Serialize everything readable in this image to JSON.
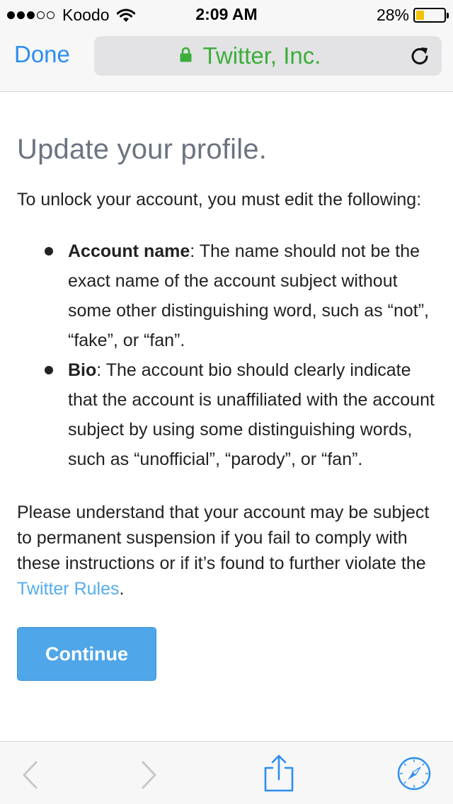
{
  "status_bar": {
    "carrier": "Koodo",
    "time": "2:09 AM",
    "battery": "28%",
    "battery_level": 0.28,
    "signal_bars_filled": 3,
    "signal_bars_total": 5
  },
  "nav": {
    "done_label": "Done",
    "url_text": "Twitter, Inc.",
    "secure_color": "#3aae3a"
  },
  "page": {
    "title": "Update your profile.",
    "intro": "To unlock your account, you must edit the following:",
    "rules": [
      {
        "term": "Account name",
        "text": ": The name should not be the exact name of the account subject without some other distinguishing word, such as “not”, “fake”, or “fan”."
      },
      {
        "term": "Bio",
        "text": ": The account bio should clearly indicate that the account is unaffiliated with the account subject by using some distinguishing words, such as “unofficial”, “parody”, or “fan”."
      }
    ],
    "closing_text": "Please understand that your account may be subject to permanent suspension if you fail to comply with these instructions or if it’s found to further violate the ",
    "rules_link": "Twitter Rules",
    "closing_end": ".",
    "continue_label": "Continue"
  },
  "toolbar": {
    "icons": [
      "back-icon",
      "forward-icon",
      "share-icon",
      "compass-icon"
    ]
  },
  "colors": {
    "accent": "#2a8ef0",
    "link": "#55acee",
    "button": "#4fa6e8",
    "title": "#6b7480"
  }
}
